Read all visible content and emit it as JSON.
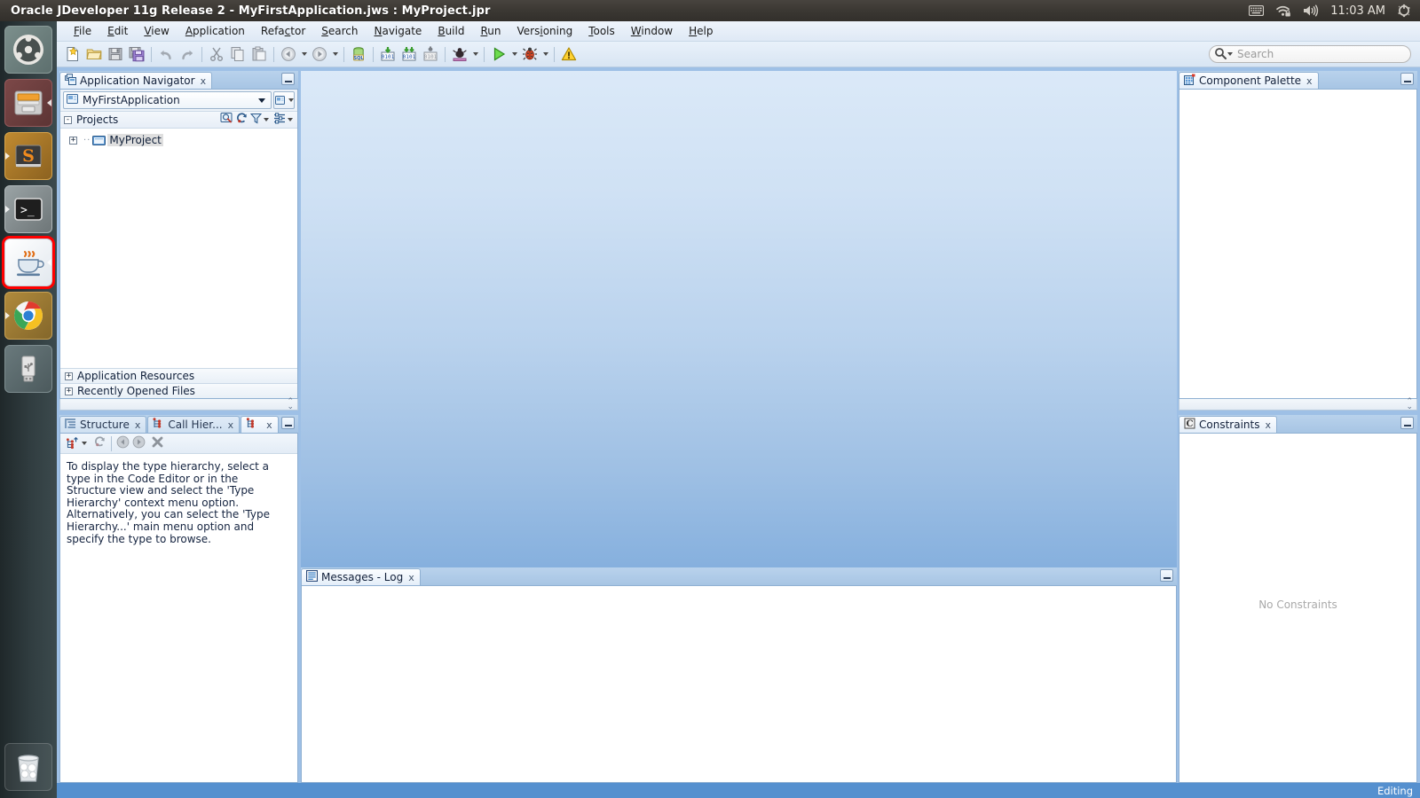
{
  "window": {
    "title": "Oracle JDeveloper 11g Release 2 - MyFirstApplication.jws : MyProject.jpr"
  },
  "tray": {
    "clock": "11:03 AM",
    "icons": [
      "keyboard-icon",
      "wifi-locked-icon",
      "volume-icon",
      "power-gear-icon"
    ]
  },
  "launcher": {
    "items": [
      {
        "name": "ubuntu-dash-icon",
        "label": "Ubuntu Dash",
        "running": false,
        "active": false
      },
      {
        "name": "file-manager-icon",
        "label": "Files",
        "running": true,
        "active": false
      },
      {
        "name": "sublime-text-icon",
        "label": "Sublime Text",
        "running": true,
        "active": false
      },
      {
        "name": "terminal-icon",
        "label": "Terminal",
        "running": true,
        "active": false
      },
      {
        "name": "jdeveloper-java-icon",
        "label": "Oracle JDeveloper",
        "running": true,
        "active": true
      },
      {
        "name": "chrome-icon",
        "label": "Google Chrome",
        "running": true,
        "active": false
      },
      {
        "name": "usb-drive-icon",
        "label": "USB Drive",
        "running": false,
        "active": false
      }
    ],
    "trash": {
      "name": "trash-icon",
      "label": "Trash"
    }
  },
  "menubar": {
    "items": [
      {
        "label": "File",
        "mnemonic": "F"
      },
      {
        "label": "Edit",
        "mnemonic": "E"
      },
      {
        "label": "View",
        "mnemonic": "V"
      },
      {
        "label": "Application",
        "mnemonic": "A"
      },
      {
        "label": "Refactor",
        "mnemonic": "c"
      },
      {
        "label": "Search",
        "mnemonic": "S"
      },
      {
        "label": "Navigate",
        "mnemonic": "N"
      },
      {
        "label": "Build",
        "mnemonic": "B"
      },
      {
        "label": "Run",
        "mnemonic": "R"
      },
      {
        "label": "Versioning",
        "mnemonic": "i"
      },
      {
        "label": "Tools",
        "mnemonic": "T"
      },
      {
        "label": "Window",
        "mnemonic": "W"
      },
      {
        "label": "Help",
        "mnemonic": "H"
      }
    ]
  },
  "toolbar": {
    "buttons": [
      "new-file-icon",
      "open-file-icon",
      "save-icon",
      "save-all-icon",
      "undo-icon",
      "redo-icon",
      "cut-icon",
      "copy-icon",
      "paste-icon",
      "navigate-back-icon",
      "navigate-forward-icon",
      "sql-worksheet-icon",
      "make-icon",
      "rebuild-icon",
      "run-ant-icon",
      "profile-icon",
      "run-icon",
      "debug-icon",
      "audit-warning-icon"
    ]
  },
  "search": {
    "placeholder": "Search",
    "value": "",
    "icon": "search-magnifier-icon"
  },
  "navigator": {
    "tab": {
      "label": "Application Navigator",
      "icon": "application-navigator-icon",
      "close": "x"
    },
    "minimize": "minimize-icon",
    "application_combo": {
      "value": "MyFirstApplication",
      "icon": "application-icon"
    },
    "application_menu_button": "application-menu-icon",
    "projects": {
      "label": "Projects",
      "expander": "-",
      "tools": [
        "filter-search-icon",
        "refresh-icon",
        "working-sets-icon",
        "navigator-display-options-icon"
      ]
    },
    "tree": [
      {
        "label": "MyProject",
        "icon": "project-folder-icon",
        "expander": "+",
        "selected": true
      }
    ],
    "sections": [
      {
        "label": "Application Resources",
        "expander": "+"
      },
      {
        "label": "Recently Opened Files",
        "expander": "+"
      }
    ]
  },
  "structure": {
    "tabs": [
      {
        "label": "Structure",
        "icon": "structure-icon",
        "close": "x",
        "active": false
      },
      {
        "label": "Call Hier...",
        "icon": "call-hierarchy-icon",
        "close": "x",
        "active": false
      },
      {
        "label": "",
        "icon": "type-hierarchy-icon",
        "close": "x",
        "active": true
      }
    ],
    "minimize": "minimize-icon",
    "toolbar": [
      "new-type-hierarchy-icon",
      "refresh-icon",
      "back-icon",
      "forward-icon",
      "delete-icon"
    ],
    "message": "To display the type hierarchy, select a type in the Code Editor or in the Structure view and select the 'Type Hierarchy' context menu option.  Alternatively, you can select the 'Type Hierarchy...' main menu option and specify the type to browse."
  },
  "log": {
    "tab": {
      "label": "Messages - Log",
      "icon": "messages-log-icon",
      "close": "x"
    },
    "minimize": "minimize-icon",
    "content": ""
  },
  "palette": {
    "tab": {
      "label": "Component Palette",
      "icon": "component-palette-icon",
      "close": "x"
    },
    "minimize": "minimize-icon",
    "content": ""
  },
  "constraints": {
    "tab": {
      "label": "Constraints",
      "icon": "constraints-icon",
      "close": "x"
    },
    "minimize": "minimize-icon",
    "empty_message": "No Constraints"
  },
  "statusbar": {
    "text": "Editing"
  },
  "colors": {
    "accent_blue": "#5590cf",
    "panel_blue": "#9ec0e6",
    "titlebar": "#3b3833",
    "highlight_outline": "#ff0000",
    "editor_gradient_top": "#dbe9f8",
    "editor_gradient_bottom": "#86b0de"
  }
}
